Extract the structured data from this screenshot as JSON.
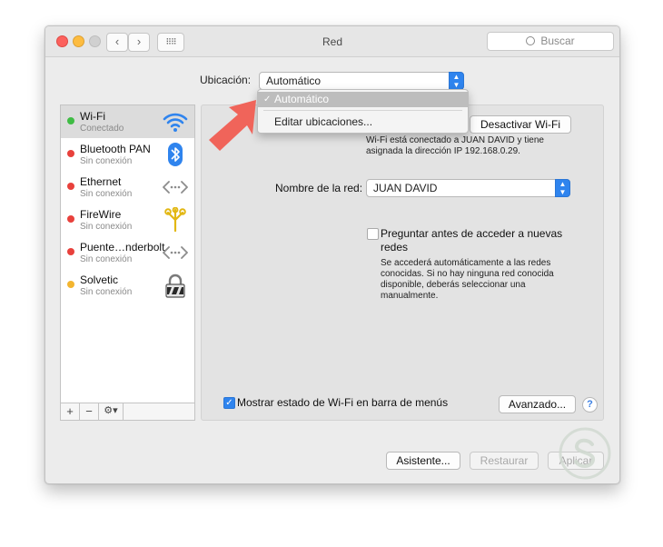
{
  "window": {
    "title": "Red"
  },
  "toolbar": {
    "back_label": "‹",
    "forward_label": "›",
    "grid_label": "⠿⠿",
    "search_placeholder": "Buscar"
  },
  "location": {
    "label": "Ubicación:",
    "value": "Automático"
  },
  "location_menu": {
    "items": [
      {
        "label": "Automático",
        "checked": true
      },
      {
        "label": "Editar ubicaciones..."
      }
    ]
  },
  "services": [
    {
      "name": "Wi-Fi",
      "status": "Conectado",
      "status_color": "#3fbc44",
      "icon": "wifi-icon"
    },
    {
      "name": "Bluetooth PAN",
      "status": "Sin conexión",
      "status_color": "#e8413c",
      "icon": "bluetooth-icon"
    },
    {
      "name": "Ethernet",
      "status": "Sin conexión",
      "status_color": "#e8413c",
      "icon": "ethernet-icon"
    },
    {
      "name": "FireWire",
      "status": "Sin conexión",
      "status_color": "#e8413c",
      "icon": "firewire-icon"
    },
    {
      "name": "Puente…nderbolt",
      "status": "Sin conexión",
      "status_color": "#e8413c",
      "icon": "thunderbolt-bridge-icon"
    },
    {
      "name": "Solvetic",
      "status": "Sin conexión",
      "status_color": "#f3b530",
      "icon": "vpn-lock-icon"
    }
  ],
  "sidebar_buttons": {
    "add": "+",
    "remove": "−",
    "action": "⚙▾"
  },
  "wifi": {
    "toggle_button": "Desactivar Wi-Fi",
    "status_text_line1": "Wi-Fi está conectado a JUAN DAVID y tiene",
    "status_text_line2": "asignada la dirección IP 192.168.0.29.",
    "network_label": "Nombre de la red:",
    "network_value": "JUAN DAVID",
    "ask_label_line1": "Preguntar antes de acceder a nuevas",
    "ask_label_line2": "redes",
    "ask_checked": false,
    "ask_help_line1": "Se accederá automáticamente a las redes",
    "ask_help_line2": "conocidas. Si no hay ninguna red conocida",
    "ask_help_line3": "disponible, deberás seleccionar una",
    "ask_help_line4": "manualmente.",
    "show_status_label": "Mostrar estado de Wi-Fi en barra de menús",
    "show_status_checked": true,
    "advanced_button": "Avanzado...",
    "help_label": "?"
  },
  "footer": {
    "assistant_button": "Asistente...",
    "revert_button": "Restaurar",
    "apply_button": "Aplicar"
  },
  "colors": {
    "accent": "#2f84ee",
    "annotation_arrow": "#f0645a"
  }
}
